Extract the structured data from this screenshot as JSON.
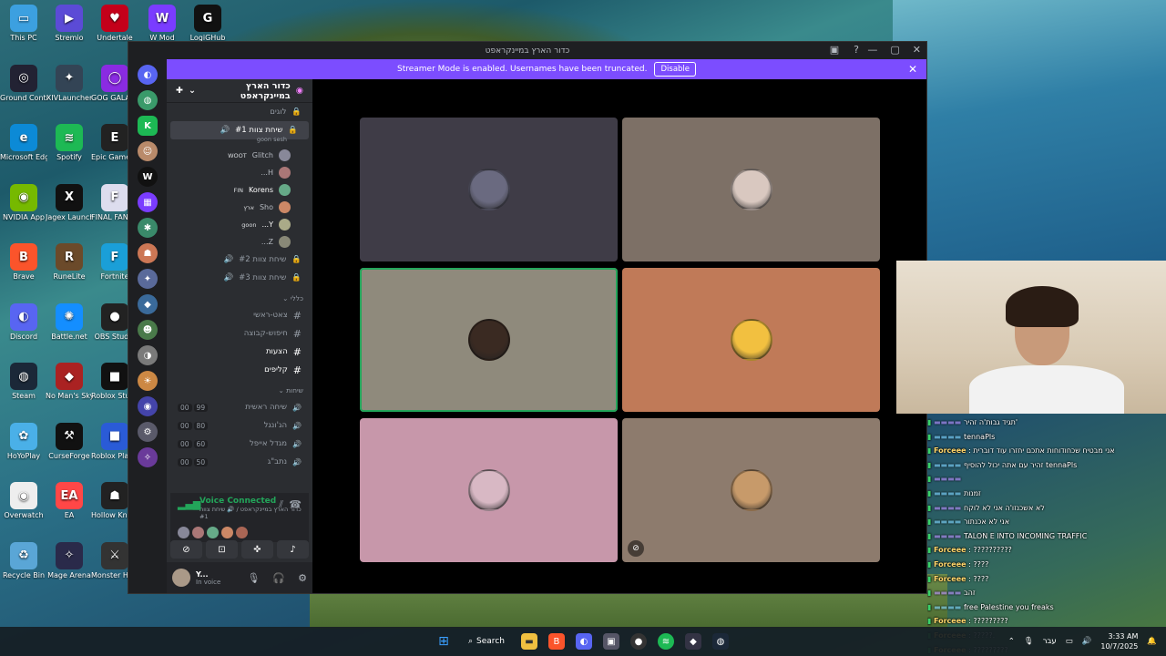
{
  "desktop_icons": [
    {
      "label": "This PC",
      "color": "#3ca0e0",
      "glyph": "▭"
    },
    {
      "label": "Stremio",
      "color": "#5b4bd6",
      "glyph": "▶"
    },
    {
      "label": "Undertale",
      "color": "#c4001a",
      "glyph": "♥"
    },
    {
      "label": "W Mod",
      "color": "#7a3cff",
      "glyph": "W"
    },
    {
      "label": "LogiGHub",
      "color": "#111",
      "glyph": "G"
    },
    {
      "label": "Ground Control",
      "color": "#223",
      "glyph": "◎"
    },
    {
      "label": "XIVLauncher",
      "color": "#345",
      "glyph": "✦"
    },
    {
      "label": "GOG GALAXY",
      "color": "#8a2be2",
      "glyph": "◯"
    },
    {
      "label": "Microsoft Edge",
      "color": "#0c8ad6",
      "glyph": "e"
    },
    {
      "label": "Spotify",
      "color": "#1db954",
      "glyph": "≋"
    },
    {
      "label": "Epic Games Launcher",
      "color": "#222",
      "glyph": "E"
    },
    {
      "label": "NVIDIA App",
      "color": "#76b900",
      "glyph": "◉"
    },
    {
      "label": "Jagex Launcher",
      "color": "#111",
      "glyph": "X"
    },
    {
      "label": "FINAL FANTASY",
      "color": "#dde",
      "glyph": "F"
    },
    {
      "label": "Brave",
      "color": "#fb542b",
      "glyph": "B"
    },
    {
      "label": "RuneLite",
      "color": "#6b4a2a",
      "glyph": "R"
    },
    {
      "label": "Fortnite",
      "color": "#1a9fd8",
      "glyph": "F"
    },
    {
      "label": "Discord",
      "color": "#5865f2",
      "glyph": "◐"
    },
    {
      "label": "Battle.net",
      "color": "#148eff",
      "glyph": "✺"
    },
    {
      "label": "OBS Studio",
      "color": "#222",
      "glyph": "●"
    },
    {
      "label": "Steam",
      "color": "#1b2838",
      "glyph": "◍"
    },
    {
      "label": "No Man's Sky",
      "color": "#a22",
      "glyph": "◆"
    },
    {
      "label": "Roblox Studio",
      "color": "#111",
      "glyph": "■"
    },
    {
      "label": "HoYoPlay",
      "color": "#4ab0e8",
      "glyph": "✿"
    },
    {
      "label": "CurseForge",
      "color": "#111",
      "glyph": "⚒"
    },
    {
      "label": "Roblox Player",
      "color": "#2a5bd7",
      "glyph": "■"
    },
    {
      "label": "Overwatch",
      "color": "#eee",
      "glyph": "◉"
    },
    {
      "label": "EA",
      "color": "#ff4747",
      "glyph": "EA"
    },
    {
      "label": "Hollow Knight",
      "color": "#222",
      "glyph": "☗"
    },
    {
      "label": "Recycle Bin",
      "color": "#5aa6d6",
      "glyph": "♻"
    },
    {
      "label": "Mage Arena",
      "color": "#2a2a4a",
      "glyph": "✧"
    },
    {
      "label": "Monster Hunter Wi...",
      "color": "#333",
      "glyph": "⚔"
    }
  ],
  "window": {
    "title": "כדור הארץ במיינקראפט",
    "controls": [
      "—",
      "▢",
      "✕"
    ]
  },
  "banner": {
    "text": "Streamer Mode is enabled. Usernames have been truncated.",
    "button": "Disable"
  },
  "guild": {
    "name": "כדור הארץ במיינקראפט",
    "channels_top": [
      {
        "name": "לוגים",
        "locked": true
      }
    ],
    "active_channel": {
      "name": "שיחת צוות #1",
      "subtitle": "goon sesh"
    },
    "members": [
      {
        "name": "Glitch",
        "tag": "WOOT",
        "color": "#889"
      },
      {
        "name": "H...",
        "tag": "",
        "color": "#a77"
      },
      {
        "name": "Korens",
        "tag": "FIN",
        "color": "#6a8",
        "bold": true
      },
      {
        "name": "Sho",
        "tag": "ארץ",
        "color": "#c86"
      },
      {
        "name": "Y...",
        "tag": "goon",
        "color": "#aa8",
        "bold": true
      },
      {
        "name": "Z...",
        "tag": "",
        "color": "#887"
      }
    ],
    "voice_channels": [
      {
        "name": "שיחת צוות #2"
      },
      {
        "name": "שיחת צוות #3"
      }
    ],
    "category_general": "כללי",
    "text_channels": [
      {
        "name": "צאט-ראשי",
        "bold": false
      },
      {
        "name": "חיפוש-קבוצה",
        "bold": false
      },
      {
        "name": "הצעות",
        "bold": true
      },
      {
        "name": "קליפים",
        "bold": true
      }
    ],
    "category_voice": "שיחות",
    "talk_channels": [
      {
        "name": "שיחה ראשית",
        "a": "00",
        "b": "99"
      },
      {
        "name": "הג'ונגל",
        "a": "00",
        "b": "80"
      },
      {
        "name": "מגדל אייפל",
        "a": "00",
        "b": "60"
      },
      {
        "name": "נתב\"ג",
        "a": "00",
        "b": "50"
      }
    ]
  },
  "voice_panel": {
    "status": "Voice Connected",
    "location": "כדור הארץ במיינקראפט / 🔊 שיחת צוות #1"
  },
  "user_panel": {
    "name": "Y...",
    "status": "In voice"
  },
  "tiles": [
    {
      "bg": "#3f3c47",
      "face": "#6a6a80",
      "speaking": false
    },
    {
      "bg": "#7d7066",
      "face": "#d9c8c0",
      "speaking": false
    },
    {
      "bg": "#8f8a7c",
      "face": "#3a2a22",
      "speaking": true
    },
    {
      "bg": "#c07a58",
      "face": "#f2c040",
      "speaking": false
    },
    {
      "bg": "#c797aa",
      "face": "#d8b8c4",
      "speaking": false
    },
    {
      "bg": "#8d7b6d",
      "face": "#c79a6a",
      "speaking": false
    }
  ],
  "chat": [
    {
      "user": "",
      "msg": "תגיד גבות'ה זהיר'",
      "cls": "n3"
    },
    {
      "user": "",
      "msg": "tennaPls",
      "cls": "n2"
    },
    {
      "user": "Forceee",
      "msg": "אני מבטיח שכחודוחות אתכם יחזרו עוד דוברית",
      "cls": "n"
    },
    {
      "user": "",
      "msg": "זהיר עם אתה יכול להוסיף tennaPls",
      "cls": "n2"
    },
    {
      "user": "",
      "msg": "",
      "cls": "n3"
    },
    {
      "user": "",
      "msg": "זמנות",
      "cls": "n2"
    },
    {
      "user": "",
      "msg": "לא אשכנזו'ה אני לא לוקח",
      "cls": "n3"
    },
    {
      "user": "",
      "msg": "אני לא אכנתור",
      "cls": "n2"
    },
    {
      "user": "",
      "msg": "TALON E INTO INCOMING TRAFFIC",
      "cls": "n3"
    },
    {
      "user": "Forceee",
      "msg": "??????????",
      "cls": "n"
    },
    {
      "user": "Forceee",
      "msg": "????",
      "cls": "n"
    },
    {
      "user": "Forceee",
      "msg": "????",
      "cls": "n"
    },
    {
      "user": "",
      "msg": "זהב",
      "cls": "n3"
    },
    {
      "user": "",
      "msg": "free Palestine you freaks",
      "cls": "n2"
    },
    {
      "user": "Forceee",
      "msg": "?????????",
      "cls": "n"
    },
    {
      "user": "Forceee",
      "msg": "?????.",
      "cls": "n"
    },
    {
      "user": "Forceee",
      "msg": "?????????",
      "cls": "n"
    }
  ],
  "taskbar": {
    "search": "Search",
    "lang": "עבר",
    "time": "3:33 AM",
    "date": "10/7/2025"
  }
}
